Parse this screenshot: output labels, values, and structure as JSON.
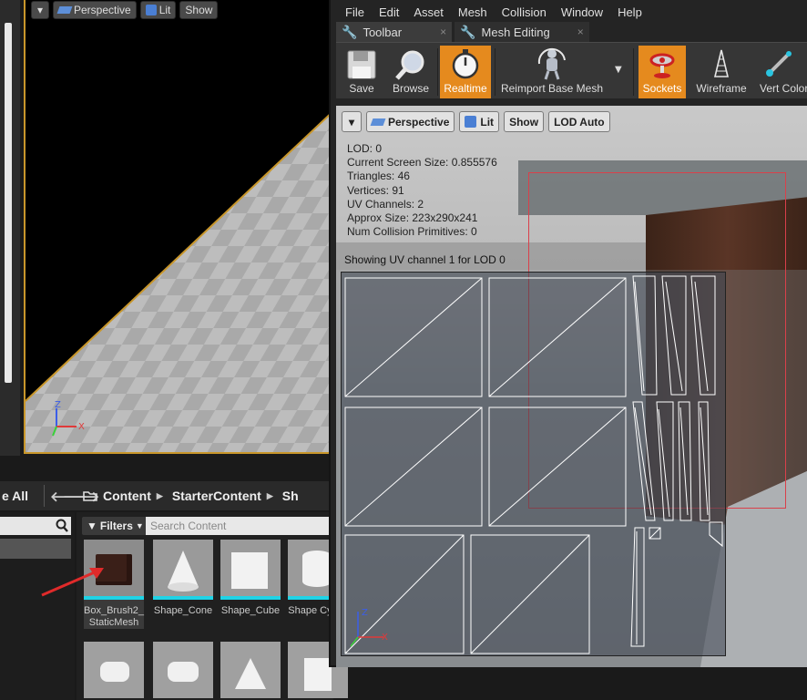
{
  "background_editor": {
    "viewport_buttons": {
      "perspective": "Perspective",
      "lit": "Lit",
      "show": "Show"
    },
    "save_all": "e All",
    "breadcrumb": [
      "Content",
      "StarterContent",
      "Sh"
    ],
    "filters_label": "Filters",
    "search_placeholder": "Search Content",
    "assets": [
      {
        "label": "Box_Brush2_ StaticMesh"
      },
      {
        "label": "Shape_Cone"
      },
      {
        "label": "Shape_Cube"
      },
      {
        "label": "Shape Cylind"
      }
    ]
  },
  "mesh_editor": {
    "menu": [
      "File",
      "Edit",
      "Asset",
      "Mesh",
      "Collision",
      "Window",
      "Help"
    ],
    "tabs": [
      {
        "label": "Toolbar",
        "close": "×"
      },
      {
        "label": "Mesh Editing",
        "close": "×"
      }
    ],
    "toolbar": {
      "save": "Save",
      "browse": "Browse",
      "realtime": "Realtime",
      "reimport": "Reimport Base Mesh",
      "sockets": "Sockets",
      "wireframe": "Wireframe",
      "vert_colors": "Vert Color"
    },
    "viewport_buttons": {
      "perspective": "Perspective",
      "lit": "Lit",
      "show": "Show",
      "lod": "LOD Auto"
    },
    "stats": {
      "lod": "LOD:  0",
      "screen_size": "Current Screen Size:  0.855576",
      "triangles": "Triangles:  46",
      "vertices": "Vertices:  91",
      "uv_channels": "UV Channels:  2",
      "approx_size": "Approx Size: 223x290x241",
      "collision": "Num Collision Primitives:  0"
    },
    "uv_caption": "Showing UV channel 1 for LOD 0"
  },
  "colors": {
    "accent": "#e58a1e",
    "cyan": "#1fd3e6",
    "selection_red": "#d9404a"
  }
}
